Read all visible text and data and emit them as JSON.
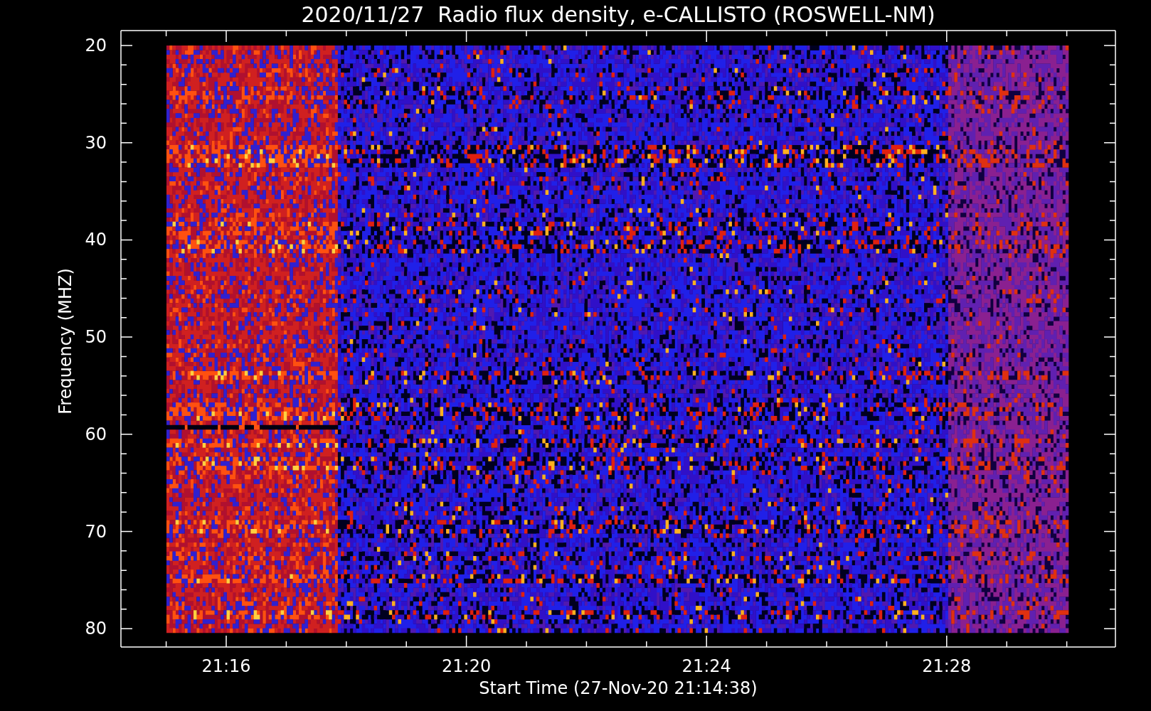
{
  "title": "2020/11/27  Radio flux density, e-CALLISTO (ROSWELL-NM)",
  "ylabel": "Frequency (MHZ)",
  "xlabel": "Start Time (27-Nov-20 21:14:38)",
  "yticks": [
    "20",
    "30",
    "40",
    "50",
    "60",
    "70",
    "80"
  ],
  "xticks": [
    "21:16",
    "21:20",
    "21:24",
    "21:28"
  ]
}
